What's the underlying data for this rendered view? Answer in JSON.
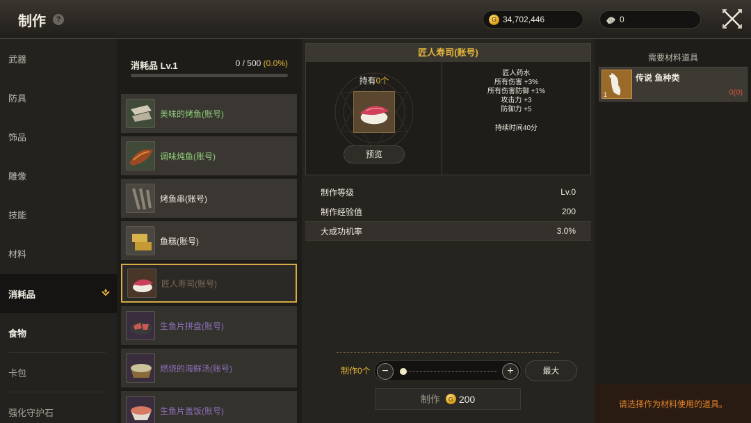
{
  "header": {
    "title": "制作",
    "help_icon": "?",
    "gold_amount": "34,702,446",
    "shell_amount": "0",
    "gold_icon": "gold-coin-icon",
    "shell_icon": "shell-icon",
    "close_icon": "close-icon"
  },
  "sidebar": {
    "items": [
      {
        "label": "武器"
      },
      {
        "label": "防具"
      },
      {
        "label": "饰品"
      },
      {
        "label": "雕像"
      },
      {
        "label": "技能"
      },
      {
        "label": "材料"
      },
      {
        "label": "消耗品"
      },
      {
        "label": "食物"
      },
      {
        "label": "卡包"
      },
      {
        "label": "强化守护石"
      }
    ]
  },
  "list": {
    "category": "消耗品 Lv.1",
    "progress_text": "0 / 500",
    "progress_pct": "(0.0%)",
    "progress_fraction": 0.0,
    "recipes": [
      {
        "name": "美味的烤鱼(账号)"
      },
      {
        "name": "调味炖鱼(账号)"
      },
      {
        "name": "烤鱼串(账号)"
      },
      {
        "name": "鱼糕(账号)"
      },
      {
        "name": "匠人寿司(账号)"
      },
      {
        "name": "生鱼片拼盘(账号)"
      },
      {
        "name": "燃烧的海鲜汤(账号)"
      },
      {
        "name": "生鱼片盖饭(账号)"
      }
    ]
  },
  "detail": {
    "title": "匠人寿司(账号)",
    "owned_prefix": "持有",
    "owned_count": "0个",
    "preview_label": "预览",
    "effects": [
      "匠人药水",
      "所有伤害 +3%",
      "所有伤害防御 +1%",
      "攻击力 +3",
      "防御力 +5"
    ],
    "duration": "持续时间40分",
    "stats": [
      {
        "label": "制作等级",
        "value": "Lv.0"
      },
      {
        "label": "制作经验值",
        "value": "200"
      },
      {
        "label": "大成功机率",
        "value": "3.0%"
      }
    ],
    "qty_label": "制作0个",
    "minus": "−",
    "plus": "+",
    "max_label": "最大",
    "craft_label": "制作",
    "craft_cost": "200"
  },
  "materials": {
    "header": "需要材料道具",
    "item_name": "传说 鱼种类",
    "item_count_badge": "1",
    "item_qty": "0(0)",
    "hint": "请选择作为材料使用的道具。"
  }
}
